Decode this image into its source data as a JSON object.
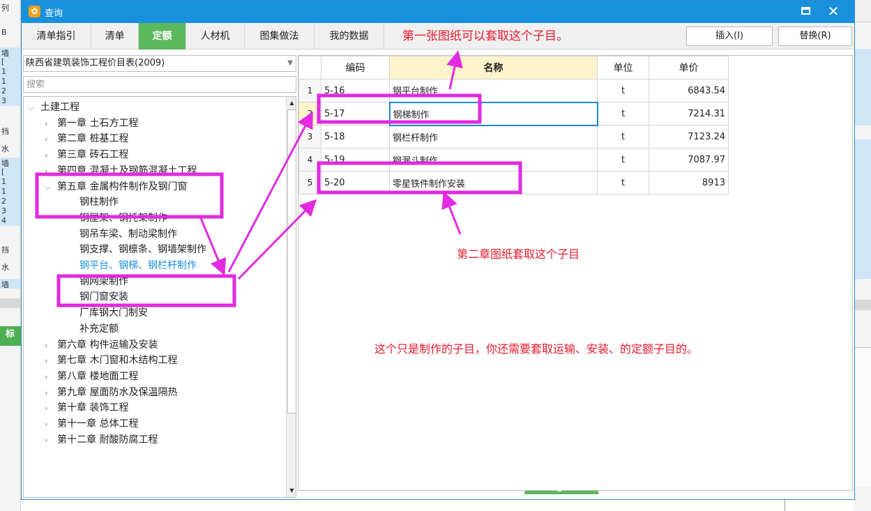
{
  "background": {
    "left_rows": [
      "列",
      "B",
      "墙",
      "[",
      "1",
      "1",
      "2",
      "3",
      "挡",
      "水",
      "墙",
      "[",
      "1",
      "1",
      "2",
      "3",
      "4",
      "挡",
      "水",
      "墙",
      "标"
    ],
    "accent": "#4caf50",
    "row_highlight": "#cfe6f7"
  },
  "dialog": {
    "title": "查询",
    "title_icon": "app-logo-icon",
    "titlebar_color": "#1990dc",
    "tabs": [
      "清单指引",
      "清单",
      "定额",
      "人材机",
      "图集做法",
      "我的数据"
    ],
    "active_tab_index": 2,
    "insert_button": "插入(I)",
    "replace_button": "替换(R)"
  },
  "left": {
    "combo_value": "陕西省建筑装饰工程价目表(2009)",
    "search_placeholder": "搜索",
    "tree": [
      {
        "label": "土建工程",
        "level": 0,
        "state": "expanded"
      },
      {
        "label": "第一章 土石方工程",
        "level": 1,
        "state": "collapsed"
      },
      {
        "label": "第二章 桩基工程",
        "level": 1,
        "state": "collapsed"
      },
      {
        "label": "第三章 砖石工程",
        "level": 1,
        "state": "collapsed"
      },
      {
        "label": "第四章 混凝土及钢筋混凝土工程",
        "level": 1,
        "state": "collapsed"
      },
      {
        "label": "第五章 金属构件制作及钢门窗",
        "level": 1,
        "state": "expanded"
      },
      {
        "label": "钢柱制作",
        "level": 2,
        "state": "leaf"
      },
      {
        "label": "钢屋架、钢托架制作",
        "level": 2,
        "state": "leaf"
      },
      {
        "label": "钢吊车梁、制动梁制作",
        "level": 2,
        "state": "leaf"
      },
      {
        "label": "钢支撑、钢檩条、钢墙架制作",
        "level": 2,
        "state": "leaf"
      },
      {
        "label": "钢平台、钢梯、钢栏杆制作",
        "level": 2,
        "state": "selected"
      },
      {
        "label": "钢网架制作",
        "level": 2,
        "state": "leaf"
      },
      {
        "label": "钢门窗安装",
        "level": 2,
        "state": "leaf"
      },
      {
        "label": "厂库钢大门制安",
        "level": 2,
        "state": "leaf"
      },
      {
        "label": "补充定额",
        "level": 2,
        "state": "leaf"
      },
      {
        "label": "第六章 构件运输及安装",
        "level": 1,
        "state": "collapsed"
      },
      {
        "label": "第七章 木门窗和木结构工程",
        "level": 1,
        "state": "collapsed"
      },
      {
        "label": "第八章 楼地面工程",
        "level": 1,
        "state": "collapsed"
      },
      {
        "label": "第九章 屋面防水及保温隔热",
        "level": 1,
        "state": "collapsed"
      },
      {
        "label": "第十章 装饰工程",
        "level": 1,
        "state": "collapsed"
      },
      {
        "label": "第十一章 总体工程",
        "level": 1,
        "state": "collapsed"
      },
      {
        "label": "第十二章 耐酸防腐工程",
        "level": 1,
        "state": "collapsed"
      }
    ]
  },
  "table": {
    "headers": [
      "",
      "编码",
      "名称",
      "单位",
      "单价"
    ],
    "rows": [
      {
        "idx": "1",
        "code": "5-16",
        "name": "钢平台制作",
        "unit": "t",
        "price": "6843.54"
      },
      {
        "idx": "2",
        "code": "5-17",
        "name": "钢梯制作",
        "unit": "t",
        "price": "7214.31"
      },
      {
        "idx": "3",
        "code": "5-18",
        "name": "钢栏杆制作",
        "unit": "t",
        "price": "7123.24"
      },
      {
        "idx": "4",
        "code": "5-19",
        "name": "钢漏斗制作",
        "unit": "t",
        "price": "7087.97"
      },
      {
        "idx": "5",
        "code": "5-20",
        "name": "零星铁件制作安装",
        "unit": "t",
        "price": "8913"
      }
    ],
    "current_row_index": 1
  },
  "annotations": {
    "note1": "第一张图纸可以套取这个子目。",
    "note2": "第二章图纸套取这个子目",
    "note3": "这个只是制作的子目，你还需要套取运输、安装、的定额子目的。",
    "color": "#e8192c",
    "frame_color": "#e22ae0"
  }
}
